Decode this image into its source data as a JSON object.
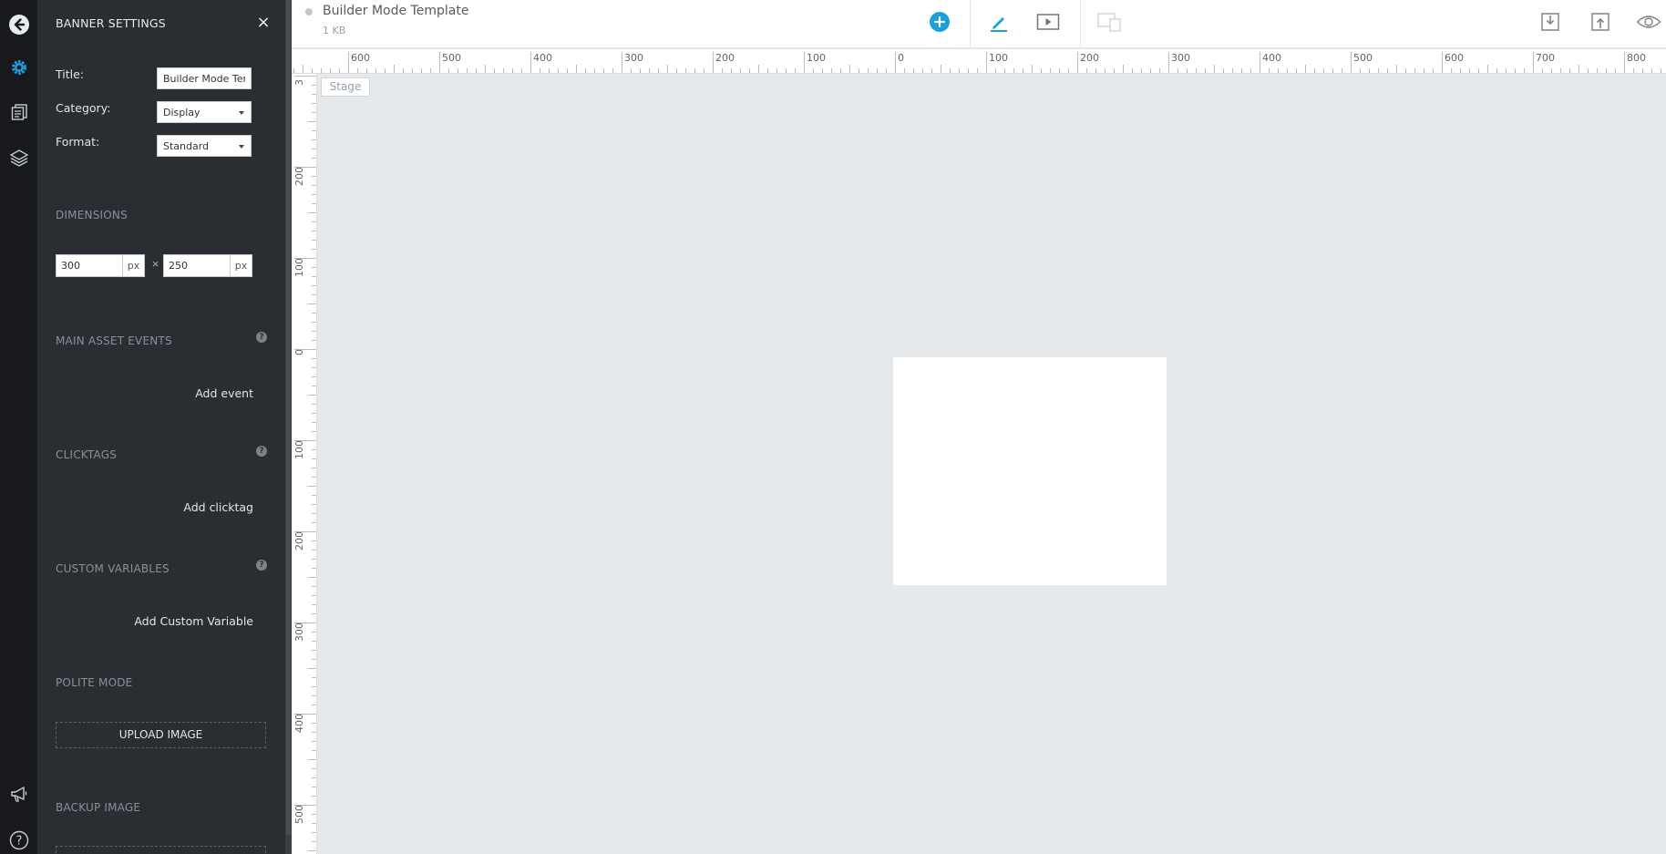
{
  "document": {
    "title": "Builder Mode Template",
    "size": "1 KB"
  },
  "panel": {
    "title": "BANNER SETTINGS",
    "close_glyph": "×",
    "fields": {
      "title_label": "Title:",
      "title_value": "Builder Mode Tem",
      "category_label": "Category:",
      "category_value": "Display",
      "format_label": "Format:",
      "format_value": "Standard"
    },
    "dimensions": {
      "heading": "DIMENSIONS",
      "width": "300",
      "height": "250",
      "unit": "px",
      "separator": "×"
    },
    "main_asset_events": {
      "heading": "MAIN ASSET EVENTS",
      "add_label": "Add event"
    },
    "clicktags": {
      "heading": "CLICKTAGS",
      "add_label": "Add clicktag"
    },
    "custom_variables": {
      "heading": "CUSTOM VARIABLES",
      "add_label": "Add Custom Variable"
    },
    "polite_mode": {
      "heading": "POLITE MODE",
      "upload_label": "UPLOAD IMAGE"
    },
    "backup_image": {
      "heading": "BACKUP IMAGE"
    },
    "help_glyph": "?"
  },
  "rail": {
    "items": [
      "back-arrow-icon",
      "gear-icon",
      "pages-icon",
      "layers-icon",
      "megaphone-icon",
      "help-icon"
    ],
    "active": "gear-icon"
  },
  "toolbar": {
    "icons": [
      "add-icon",
      "pen-icon",
      "play-icon",
      "responsive-icon",
      "download-icon",
      "upload-icon",
      "eye-icon"
    ]
  },
  "stage": {
    "label": "Stage"
  },
  "rulers": {
    "horizontal_labels": [
      "600",
      "500",
      "400",
      "300",
      "200",
      "100",
      "0",
      "100",
      "200",
      "300",
      "400",
      "500",
      "600",
      "700",
      "800"
    ],
    "vertical_labels": [
      "3",
      "200",
      "100",
      "0",
      "100",
      "200",
      "300",
      "400",
      "500"
    ]
  },
  "colors": {
    "accent": "#1a9fdf",
    "rail_bg": "#17191c",
    "panel_bg": "#2a2d32",
    "stage_bg": "#e6e9ec"
  }
}
